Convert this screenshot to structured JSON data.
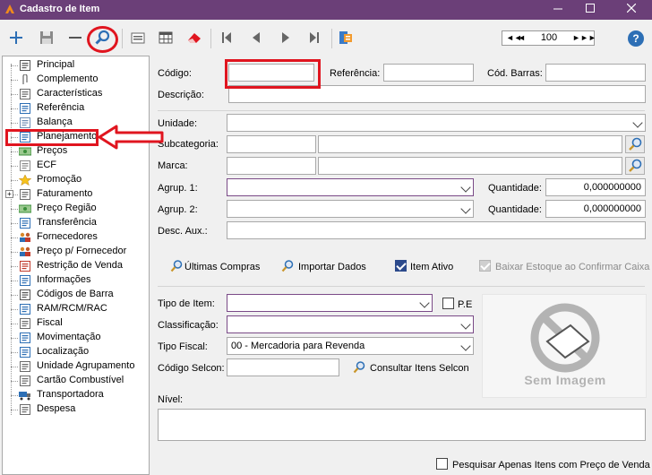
{
  "window": {
    "title": "Cadastro de Item",
    "controls": [
      "minimize",
      "maximize",
      "close"
    ]
  },
  "toolbar": {
    "pager_value": "100",
    "pager_first": "◄◄",
    "pager_prev": "◄",
    "pager_next": "►",
    "pager_last": "►►",
    "help_label": "?"
  },
  "tree": {
    "items": [
      "Principal",
      "Complemento",
      "Características",
      "Referência",
      "Balança",
      "Planejamento",
      "Preços",
      "ECF",
      "Promoção",
      "Faturamento",
      "Preço Região",
      "Transferência",
      "Fornecedores",
      "Preço p/ Fornecedor",
      "Restrição de Venda",
      "Informações",
      "Códigos de Barra",
      "RAM/RCM/RAC",
      "Fiscal",
      "Movimentação",
      "Localização",
      "Unidade Agrupamento",
      "Cartão Combustível",
      "Transportadora",
      "Despesa"
    ],
    "expand_symbol": "+"
  },
  "form": {
    "codigo_label": "Código:",
    "codigo_value": "",
    "referencia_label": "Referência:",
    "referencia_value": "",
    "cod_barras_label": "Cód. Barras:",
    "cod_barras_value": "",
    "descricao_label": "Descrição:",
    "descricao_value": "",
    "unidade_label": "Unidade:",
    "unidade_value": "",
    "subcategoria_label": "Subcategoria:",
    "marca_label": "Marca:",
    "agrup1_label": "Agrup. 1:",
    "agrup2_label": "Agrup. 2:",
    "quantidade1_label": "Quantidade:",
    "quantidade1_value": "0,000000000",
    "quantidade2_label": "Quantidade:",
    "quantidade2_value": "0,000000000",
    "desc_aux_label": "Desc. Aux.:",
    "ultimas_compras": "Últimas Compras",
    "importar_dados": "Importar Dados",
    "item_ativo": "Item Ativo",
    "baixar_estoque": "Baixar Estoque ao Confirmar Caixa",
    "tipo_item_label": "Tipo de Item:",
    "pe_label": "P.E",
    "classificacao_label": "Classificação:",
    "tipo_fiscal_label": "Tipo Fiscal:",
    "tipo_fiscal_value": "00 - Mercadoria para Revenda",
    "codigo_selcon_label": "Código Selcon:",
    "consultar_selcon": "Consultar Itens Selcon",
    "sem_imagem": "Sem Imagem",
    "nivel_label": "Nível:",
    "pesquisar_apenas": "Pesquisar Apenas Itens com Preço de Venda"
  },
  "colors": {
    "titlebar": "#6b3f78",
    "highlight": "#e0151f",
    "checkbox_checked": "#2c4a8c"
  }
}
